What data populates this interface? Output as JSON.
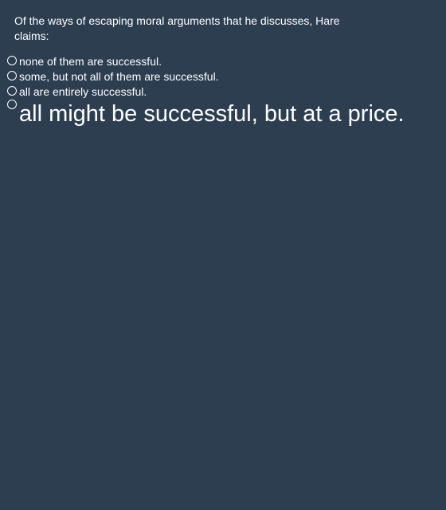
{
  "question": {
    "text": "Of the ways of escaping moral arguments that he discusses, Hare claims:"
  },
  "options": [
    {
      "label": "none of them are successful."
    },
    {
      "label": "some, but not all of them are successful."
    },
    {
      "label": "all are entirely successful."
    },
    {
      "label": "all might be successful, but at a price."
    }
  ]
}
